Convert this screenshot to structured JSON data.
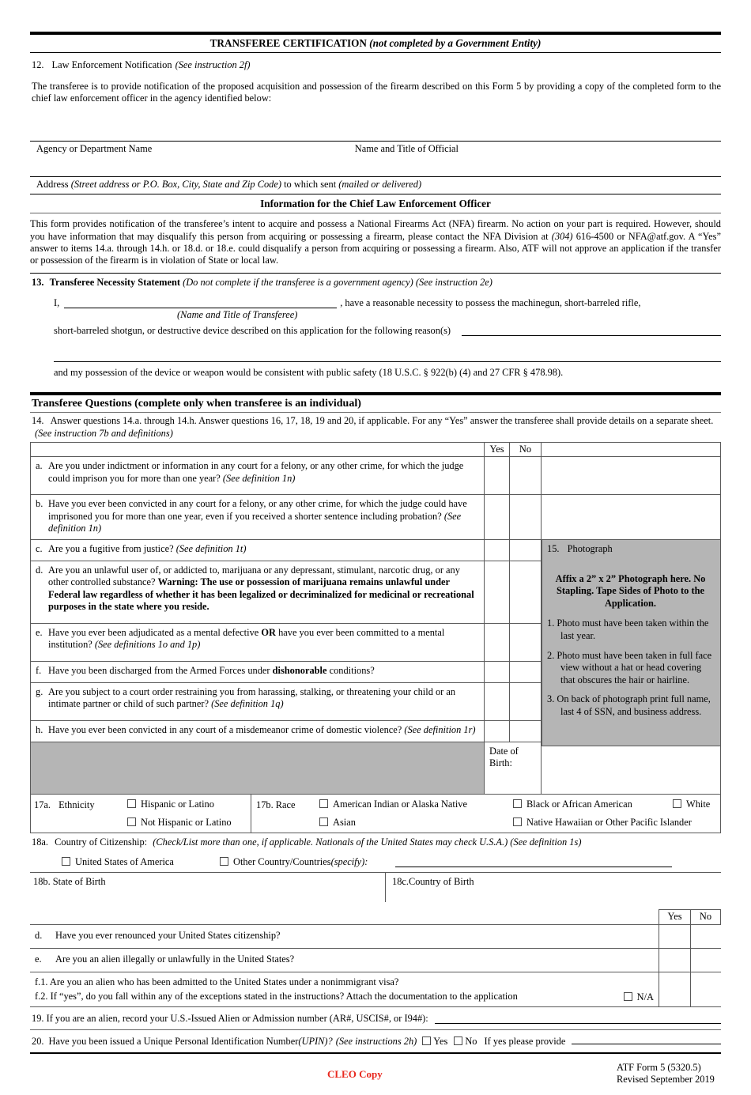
{
  "header": {
    "title": "TRANSFEREE CERTIFICATION",
    "title_note": "(not completed by a Government Entity)"
  },
  "item12": {
    "number": "12.",
    "label": "Law Enforcement Notification",
    "instruction": "(See instruction 2f)",
    "body": "The transferee is to provide notification of the proposed acquisition and possession of the firearm described on this Form 5 by providing a copy of the completed form to the chief law enforcement officer in the agency identified below:",
    "field_agency": "Agency or Department Name",
    "field_official": "Name and Title of Official",
    "field_address_label": "Address",
    "field_address_note": "(Street address or P.O. Box, City, State and Zip Code)",
    "field_address_mid": "to which sent",
    "field_address_note2": "(mailed or delivered)"
  },
  "cleo_info": {
    "heading": "Information for the Chief Law Enforcement Officer",
    "p1a": "This form provides notification of the transferee’s intent to acquire and possess a National Firearms Act (NFA) firearm.  No action on your part is required.  However, should you have information that may disqualify this person from acquiring or possessing a firearm, please contact the NFA Division at ",
    "phone": "(304)",
    "p1b": " 616-4500 or NFA@atf.gov.  A “Yes” answer to items 14.a. through 14.h. or 18.d. or 18.e. could disqualify a person from acquiring or possessing a firearm.  Also, ATF will not approve an application if the transfer or possession of the firearm is in violation of State or local law."
  },
  "item13": {
    "number": "13.",
    "title": "Transferee Necessity Statement",
    "note1": "(Do not complete if the transferee is a government agency)",
    "note2": "(See instruction 2e)",
    "i_label": "I,",
    "after_blank": ", have a reasonable necessity to possess the machinegun, short-barreled rifle,",
    "blank_caption": "(Name and Title of Transferee)",
    "line2": "short-barreled shotgun, or destructive device described on this application for the following reason(s)",
    "closing": "and my possession of the device or weapon would be consistent with public safety (18 U.S.C. § 922(b) (4) and 27 CFR § 478.98)."
  },
  "questions_section": {
    "title": "Transferee Questions (complete only when transferee is an individual)",
    "item14_number": "14.",
    "item14_text": "Answer questions 14.a. through 14.h.  Answer questions 16, 17, 18, 19 and 20, if applicable.  For any  “Yes”  answer the transferee shall provide details on a separate sheet.",
    "item14_note": "(See instruction 7b and definitions)",
    "yes": "Yes",
    "no": "No",
    "rows": [
      {
        "letter": "a.",
        "text": "Are you under indictment or information in any court for a felony, or any other crime, for which the judge could imprison you for more than one year? ",
        "note": "(See definition 1n)"
      },
      {
        "letter": "b.",
        "text": "Have you ever been convicted in any court for a felony, or any other crime, for which the judge could have imprisoned you for more than one year, even if you received a shorter sentence including probation? ",
        "note": "(See definition 1n)"
      },
      {
        "letter": "c.",
        "text": "Are you a fugitive from justice? ",
        "note": "(See definition 1t)"
      },
      {
        "letter": "d.",
        "text": "Are you an unlawful user of, or addicted to, marijuana or any depressant, stimulant, narcotic drug, or  any other controlled substance? ",
        "bold": "Warning: The use or possession of marijuana remains unlawful under Federal law regardless of whether it has been legalized or decriminalized for medicinal or recreational purposes in the state where you reside.",
        "note": ""
      },
      {
        "letter": "e.",
        "text_pre": "Have you ever been adjudicated as a mental defective ",
        "bold": "OR",
        "text_post": " have you ever been committed to a mental institution? ",
        "note": "(See definitions 1o and 1p)"
      },
      {
        "letter": "f.",
        "text_pre": "Have you been discharged from the Armed Forces under ",
        "bold": "dishonorable",
        "text_post": " conditions?",
        "note": ""
      },
      {
        "letter": "g.",
        "text": "Are you subject to a court order restraining you from harassing, stalking, or threatening your child or an intimate partner or child of such partner? ",
        "note": "(See definition 1q)"
      },
      {
        "letter": "h.",
        "text": "Have you ever been convicted in any court of a misdemeanor crime of domestic violence? ",
        "note": "(See definition 1r)"
      }
    ]
  },
  "item15": {
    "number": "15.",
    "label": "Photograph",
    "affix": "Affix a 2” x 2” Photograph here. No Stapling.  Tape Sides of Photo to the Application",
    "affix_period": ".",
    "notes": [
      "1.  Photo must have been taken within the last year.",
      "2.  Photo must have been taken in full face view without a hat or head covering that obscures the hair or hairline.",
      "3.  On back of photograph print full name, last 4 of SSN, and business address."
    ]
  },
  "dob": {
    "label": "Date of Birth:"
  },
  "item17": {
    "a_number": "17a.",
    "a_label": "Ethnicity",
    "a_options": [
      "Hispanic or Latino",
      "Not Hispanic or Latino"
    ],
    "b_number": "17b. Race",
    "b_options_row1": [
      "American Indian or Alaska Native",
      "Black or African American",
      "White"
    ],
    "b_options_row2": [
      "Asian",
      "Native Hawaiian or Other Pacific Islander"
    ]
  },
  "item18": {
    "a_number": "18a.",
    "a_label": "Country of Citizenship:",
    "a_note": "(Check/List more than one, if applicable.  Nationals of the United States may check U.S.A.) (See definition 1s)",
    "a_opt_usa": "United States of America",
    "a_opt_other": "Other Country/Countries",
    "a_opt_other_note": "(specify):",
    "b_label": "18b. State of Birth",
    "c_label": "18c.Country of Birth",
    "yes": "Yes",
    "no": "No",
    "rows": [
      {
        "letter": "d.",
        "text": "Have you ever renounced your United States citizenship?"
      },
      {
        "letter": "e.",
        "text": "Are you an alien illegally or unlawfully in the United States?"
      }
    ],
    "f1": "f.1. Are you an alien who has been admitted to the United States under a nonimmigrant visa?",
    "f2": "f.2. If “yes”, do you fall within any of the exceptions stated in the instructions? Attach the documentation to the application",
    "na": "N/A"
  },
  "item19": {
    "text": "19. If you are an alien, record your U.S.-Issued Alien or Admission number (AR#, USCIS#, or I94#):"
  },
  "item20": {
    "number": "20.",
    "text": "Have you been issued a Unique Personal Identification Number ",
    "upin": "(UPIN)?",
    "instructions": "(See instructions 2h)",
    "yes": "Yes",
    "no": "No",
    "tail": "If yes please provide"
  },
  "footer": {
    "cleo_copy": "CLEO Copy",
    "form_no": "ATF Form 5 (5320.5)",
    "revised": "Revised September 2019"
  },
  "colors": {
    "gray_panel": "#b5b5b5",
    "cleo_red": "#e8281e",
    "rule": "#000000"
  }
}
